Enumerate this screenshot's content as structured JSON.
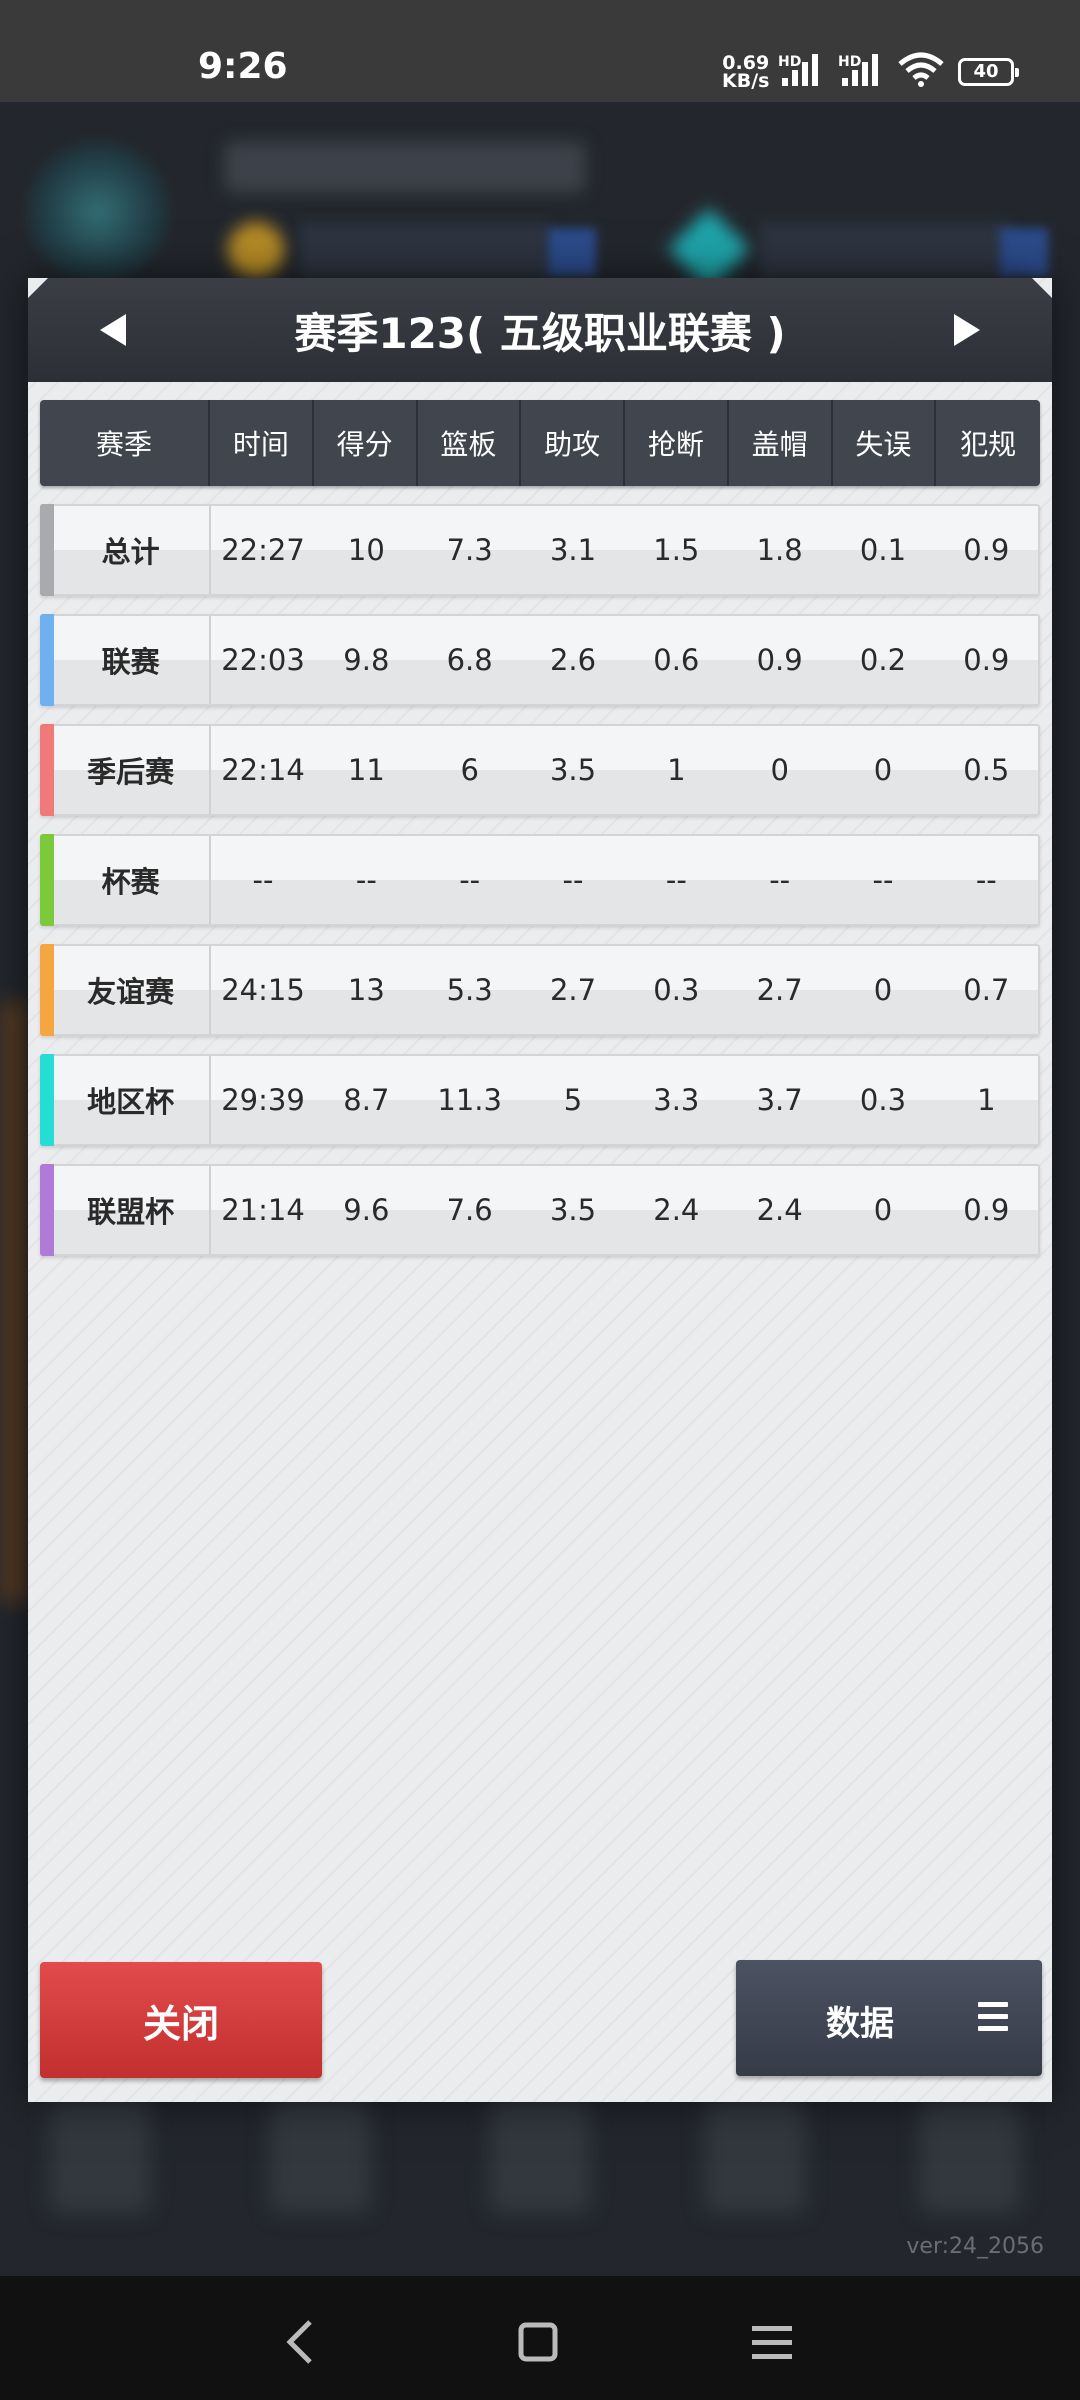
{
  "status_bar": {
    "time": "9:26",
    "net_speed_value": "0.69",
    "net_speed_unit": "KB/s",
    "hd1": "HD",
    "hd2": "HD",
    "battery": "40"
  },
  "dialog": {
    "title": "赛季123( 五级职业联赛 )"
  },
  "table": {
    "headers": [
      "赛季",
      "时间",
      "得分",
      "篮板",
      "助攻",
      "抢断",
      "盖帽",
      "失误",
      "犯规"
    ],
    "rows": [
      {
        "name": "总计",
        "accent": "#a9aaad",
        "values": [
          "22:27",
          "10",
          "7.3",
          "3.1",
          "1.5",
          "1.8",
          "0.1",
          "0.9"
        ]
      },
      {
        "name": "联赛",
        "accent": "#6fb0f0",
        "values": [
          "22:03",
          "9.8",
          "6.8",
          "2.6",
          "0.6",
          "0.9",
          "0.2",
          "0.9"
        ]
      },
      {
        "name": "季后赛",
        "accent": "#f07a7a",
        "values": [
          "22:14",
          "11",
          "6",
          "3.5",
          "1",
          "0",
          "0",
          "0.5"
        ]
      },
      {
        "name": "杯赛",
        "accent": "#7cc93b",
        "values": [
          "--",
          "--",
          "--",
          "--",
          "--",
          "--",
          "--",
          "--"
        ]
      },
      {
        "name": "友谊赛",
        "accent": "#f5a640",
        "values": [
          "24:15",
          "13",
          "5.3",
          "2.7",
          "0.3",
          "2.7",
          "0",
          "0.7"
        ]
      },
      {
        "name": "地区杯",
        "accent": "#26ddd6",
        "values": [
          "29:39",
          "8.7",
          "11.3",
          "5",
          "3.3",
          "3.7",
          "0.3",
          "1"
        ]
      },
      {
        "name": "联盟杯",
        "accent": "#b07ad8",
        "values": [
          "21:14",
          "9.6",
          "7.6",
          "3.5",
          "2.4",
          "2.4",
          "0",
          "0.9"
        ]
      }
    ]
  },
  "buttons": {
    "close_label": "关闭",
    "data_label": "数据"
  },
  "footer": {
    "version": "ver:24_2056"
  },
  "icons": {
    "prev": "triangle-left-icon",
    "next": "triangle-right-icon",
    "menu": "hamburger-menu-icon",
    "nav_back": "chevron-left-icon",
    "nav_home": "square-icon",
    "nav_recents": "hamburger-menu-icon"
  }
}
